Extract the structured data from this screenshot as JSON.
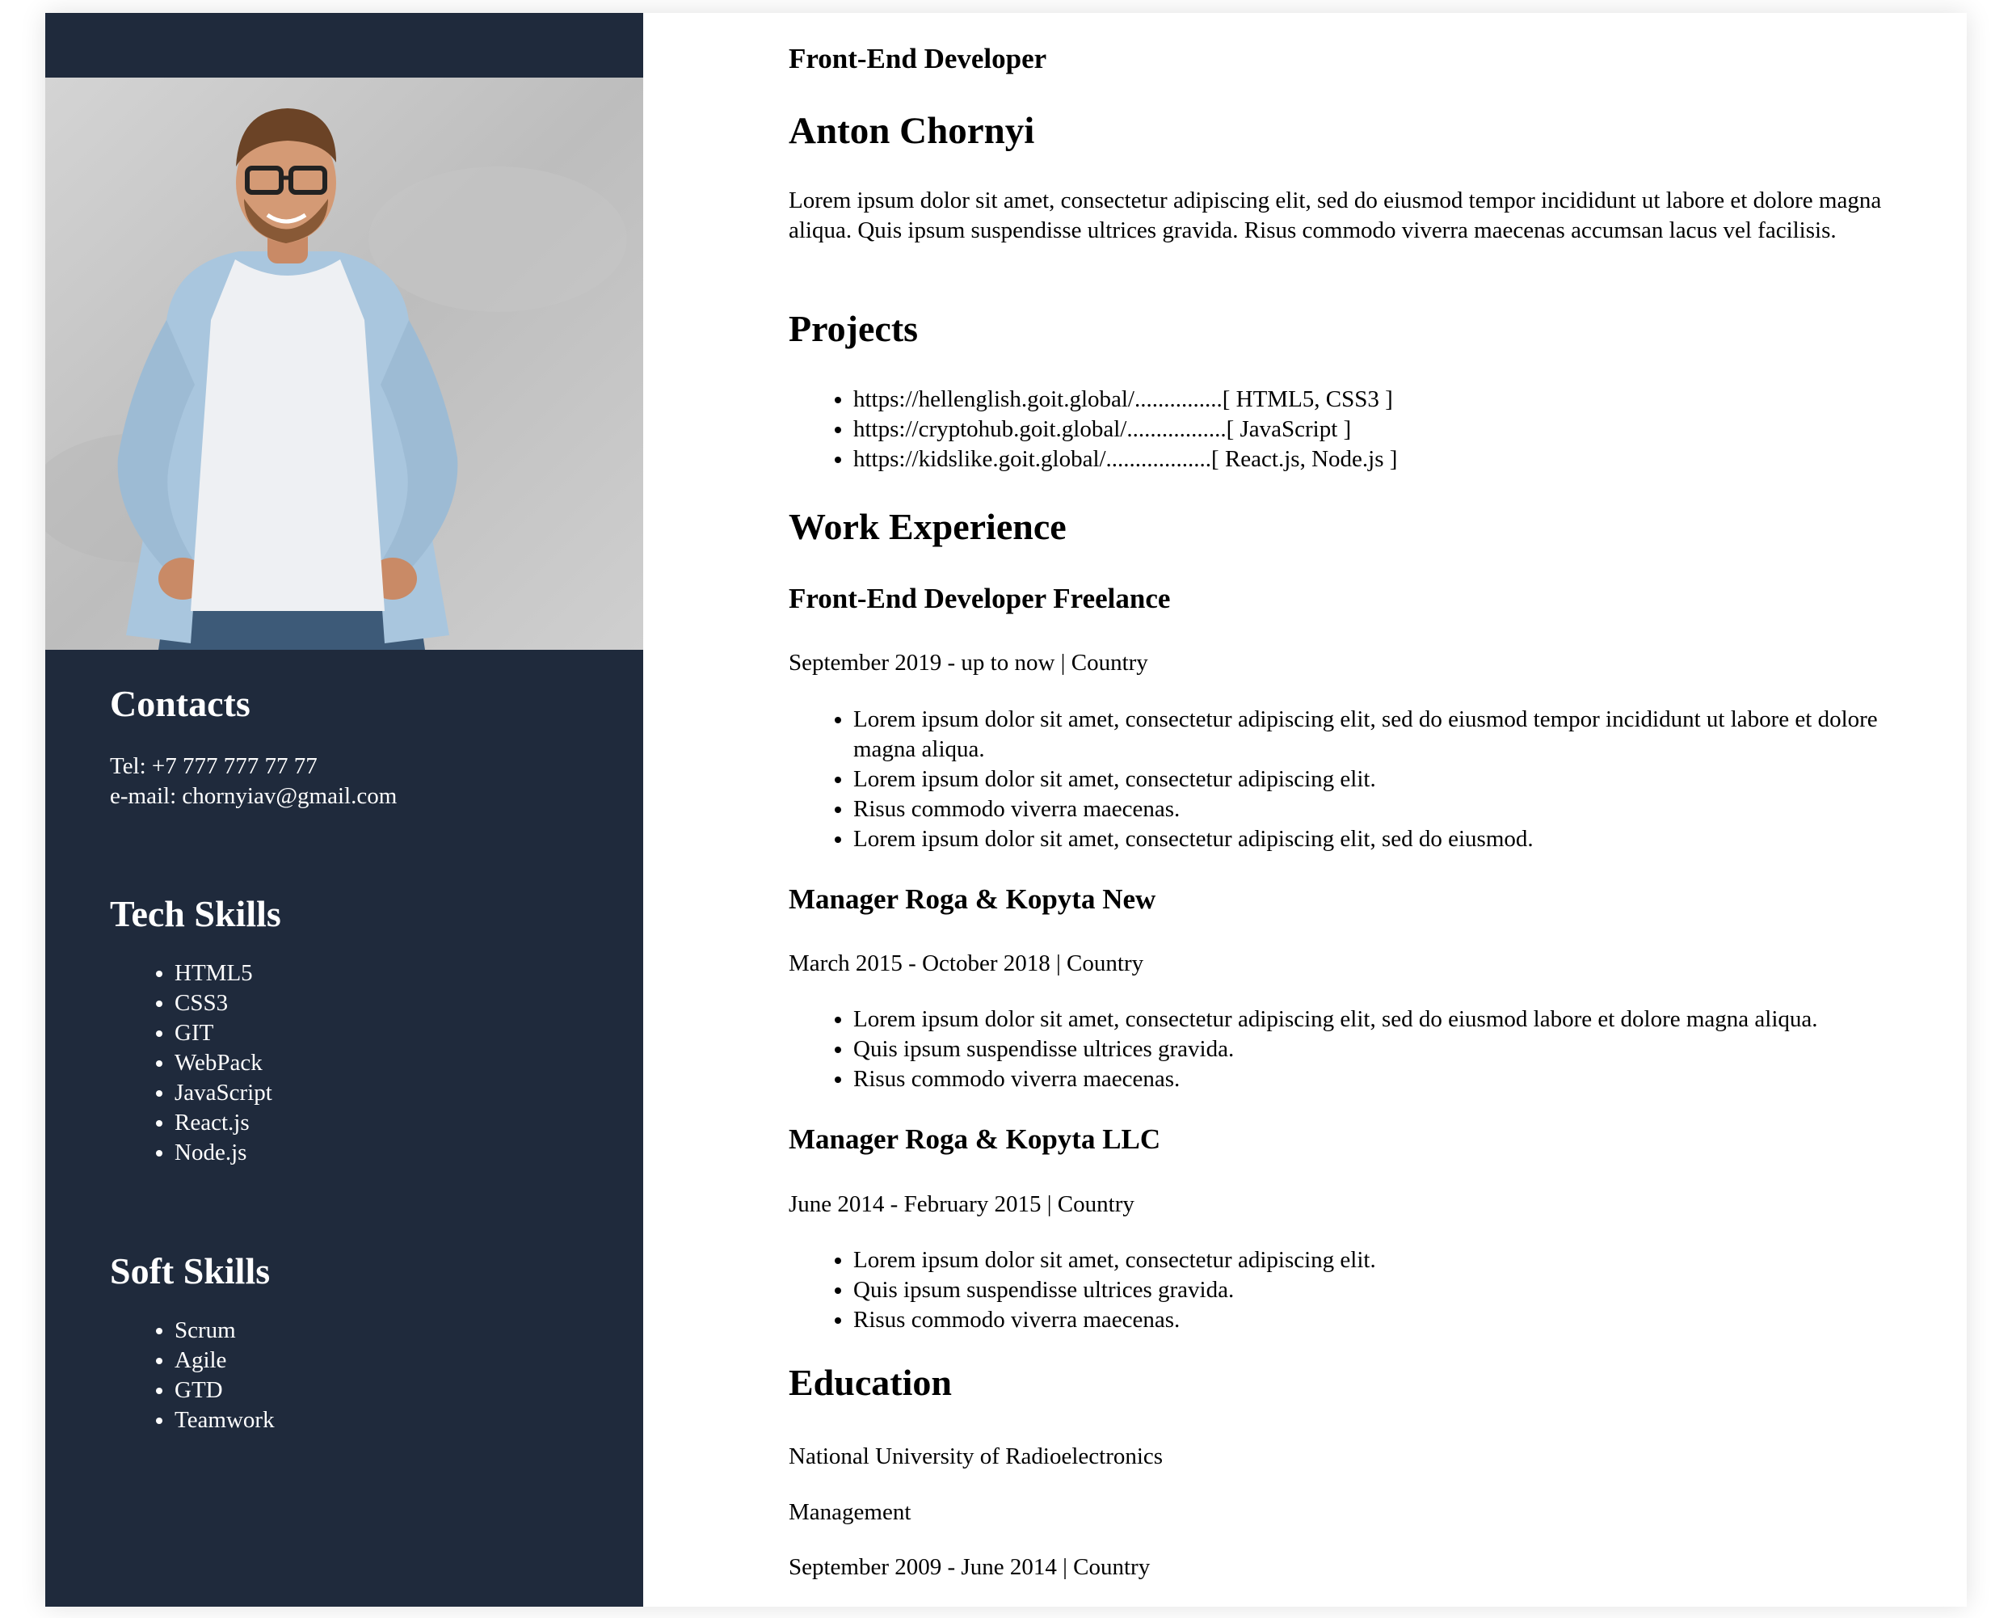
{
  "sidebar": {
    "contacts": {
      "title": "Contacts",
      "tel": "Tel: +7 777 777 77 77",
      "email": "e-mail: chornyiav@gmail.com"
    },
    "tech_skills": {
      "title": "Tech Skills",
      "items": [
        "HTML5",
        "CSS3",
        "GIT",
        "WebPack",
        "JavaScript",
        "React.js",
        "Node.js"
      ]
    },
    "soft_skills": {
      "title": "Soft Skills",
      "items": [
        "Scrum",
        "Agile",
        "GTD",
        "Teamwork"
      ]
    }
  },
  "header": {
    "role": "Front-End Developer",
    "name": "Anton Chornyi",
    "summary": "Lorem ipsum dolor sit amet, consectetur adipiscing elit, sed do eiusmod tempor incididunt ut labore et dolore magna aliqua. Quis ipsum suspendisse ultrices gravida. Risus commodo viverra maecenas accumsan lacus vel facilisis."
  },
  "projects": {
    "title": "Projects",
    "items": [
      "https://hellenglish.goit.global/...............[ HTML5, CSS3 ]",
      "https://cryptohub.goit.global/.................[ JavaScript ]",
      "https://kidslike.goit.global/..................[ React.js, Node.js ]"
    ]
  },
  "work": {
    "title": "Work Experience",
    "jobs": [
      {
        "title": "Front-End Developer Freelance",
        "period": "September 2019 - up to now | Country",
        "duties": [
          "Lorem ipsum dolor sit amet, consectetur adipiscing elit, sed do eiusmod tempor incididunt ut labore et dolore magna aliqua.",
          "Lorem ipsum dolor sit amet, consectetur adipiscing elit.",
          "Risus commodo viverra maecenas.",
          "Lorem ipsum dolor sit amet, consectetur adipiscing elit, sed do eiusmod."
        ]
      },
      {
        "title": "Manager Roga & Kopyta New",
        "period": "March 2015 - October 2018 | Country",
        "duties": [
          "Lorem ipsum dolor sit amet, consectetur adipiscing elit, sed do eiusmod labore et dolore magna aliqua.",
          "Quis ipsum suspendisse ultrices gravida.",
          "Risus commodo viverra maecenas."
        ]
      },
      {
        "title": "Manager Roga & Kopyta LLC",
        "period": "June 2014 - February 2015 | Country",
        "duties": [
          "Lorem ipsum dolor sit amet, consectetur adipiscing elit.",
          "Quis ipsum suspendisse ultrices gravida.",
          "Risus commodo viverra maecenas."
        ]
      }
    ]
  },
  "education": {
    "title": "Education",
    "university": "National University of Radioelectronics",
    "specialty": "Management",
    "period": "September 2009 - June 2014 | Country"
  }
}
